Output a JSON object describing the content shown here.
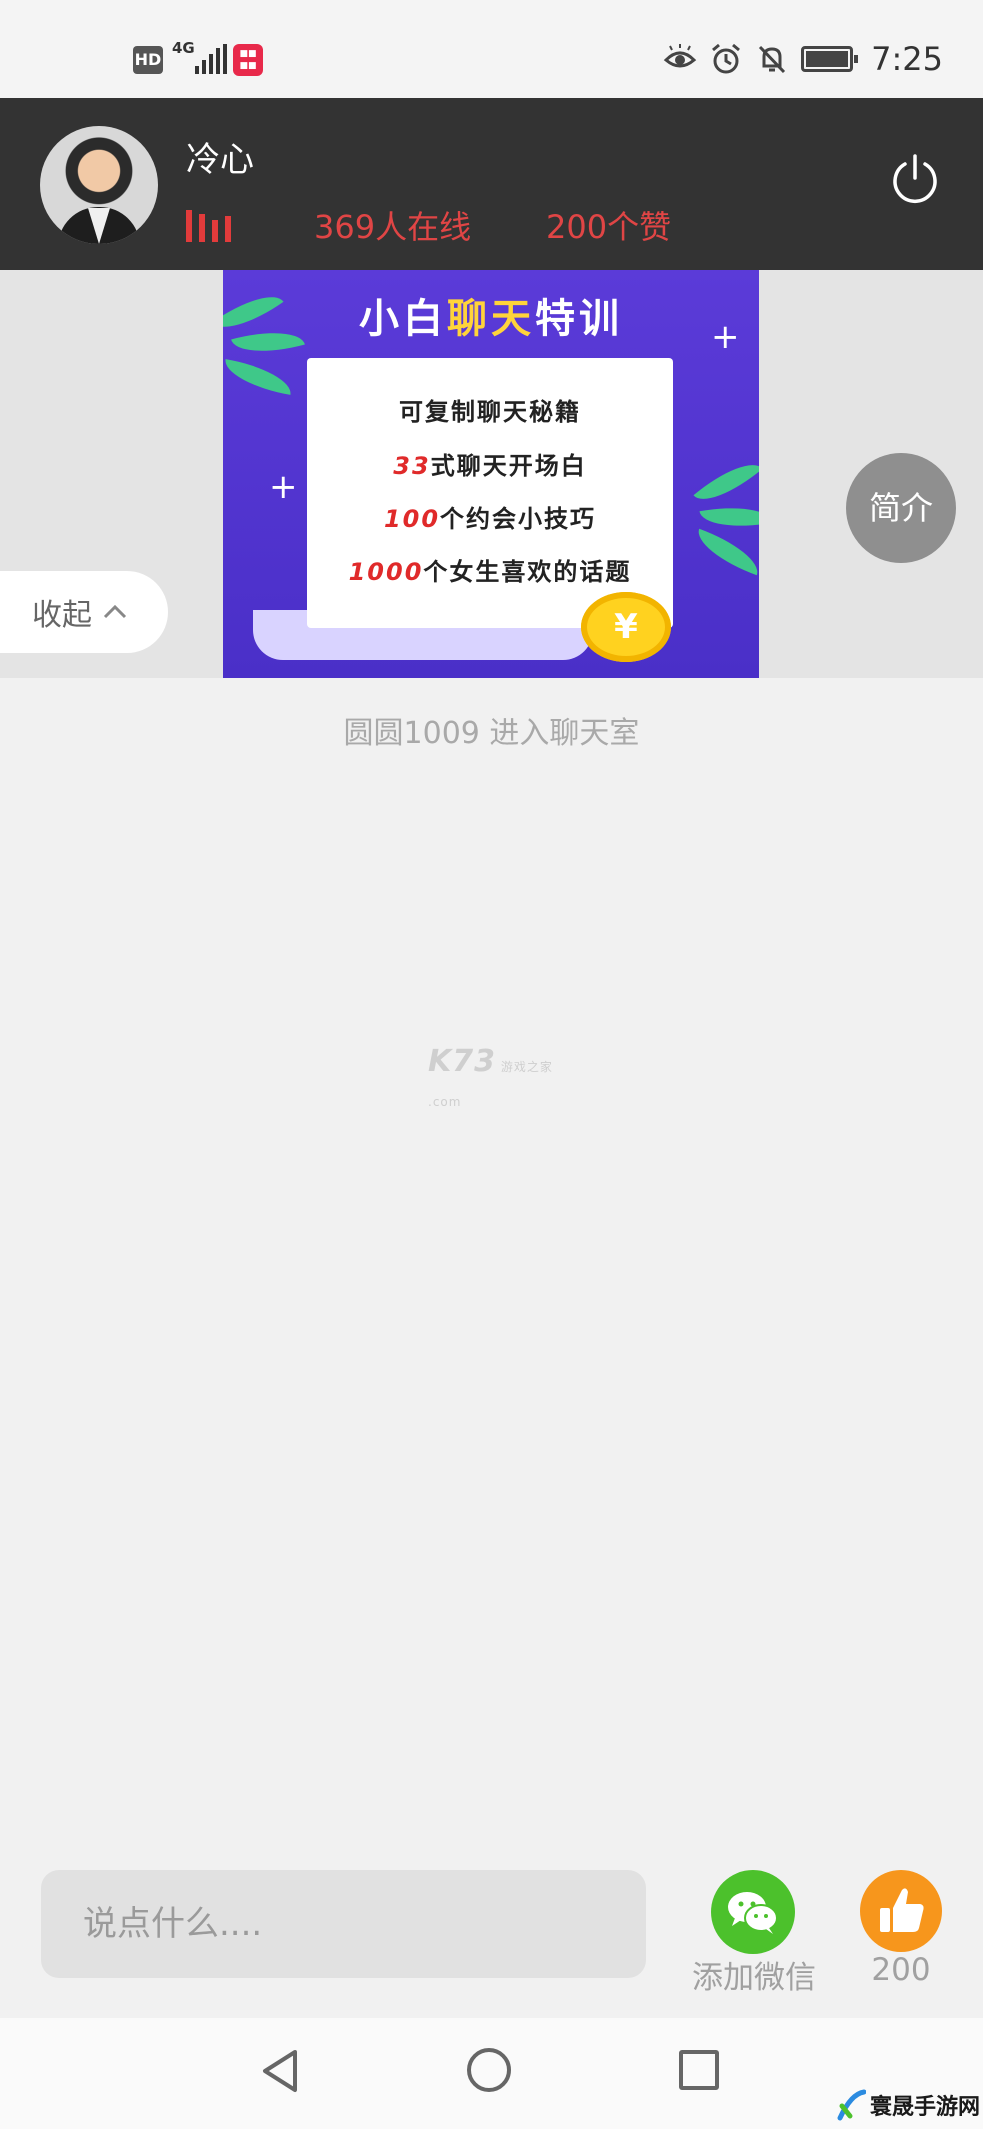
{
  "status_bar": {
    "hd": "HD",
    "network": "4G",
    "time": "7:25",
    "icons": [
      "eye-comfort-icon",
      "alarm-icon",
      "bell-off-icon",
      "battery-icon"
    ]
  },
  "header": {
    "host_name": "冷心",
    "online_count": "369人在线",
    "likes": "200个赞"
  },
  "banner": {
    "title_part1": "小白",
    "title_part2": "聊天",
    "title_part3": "特训",
    "lines": [
      {
        "red": "",
        "text": "可复制聊天秘籍"
      },
      {
        "red": "33",
        "text": "式聊天开场白"
      },
      {
        "red": "100",
        "text": "个约会小技巧"
      },
      {
        "red": "1000",
        "text": "个女生喜欢的话题"
      }
    ],
    "coin_symbol": "¥"
  },
  "intro_button": "简介",
  "collapse_button": "收起",
  "system_message": "圆圆1009  进入聊天室",
  "watermark": {
    "main": "K73",
    "sub1": "游戏之家",
    "sub2": ".com"
  },
  "bottom_bar": {
    "input_placeholder": "说点什么....",
    "wechat_label": "添加微信",
    "like_count": "200"
  },
  "corner_logo": "寰晟手游网",
  "colors": {
    "header_bg": "#333333",
    "accent_red": "#e04545",
    "wechat_green": "#4cc12c",
    "like_orange": "#f7961c",
    "banner_purple": "#5b3bd8"
  }
}
